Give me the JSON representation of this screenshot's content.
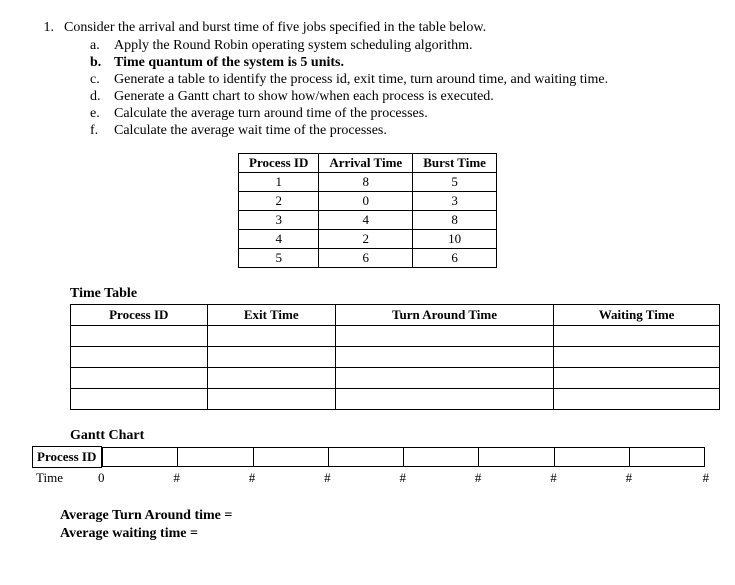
{
  "question": {
    "number": "1.",
    "main": "Consider the arrival and burst time of five jobs specified in the table below.",
    "subs": [
      {
        "letter": "a.",
        "text": "Apply the Round Robin operating system scheduling algorithm.",
        "bold": false
      },
      {
        "letter": "b.",
        "text": "Time quantum of the system is 5 units.",
        "bold": true
      },
      {
        "letter": "c.",
        "text": "Generate a table to identify the process id, exit time, turn around time, and waiting time.",
        "bold": false
      },
      {
        "letter": "d.",
        "text": "Generate a Gantt chart to show how/when each process is executed.",
        "bold": false
      },
      {
        "letter": "e.",
        "text": "Calculate the average turn around time of the processes.",
        "bold": false
      },
      {
        "letter": "f.",
        "text": "Calculate the average wait time of the processes.",
        "bold": false
      }
    ]
  },
  "process_table": {
    "headers": [
      "Process ID",
      "Arrival Time",
      "Burst Time"
    ],
    "rows": [
      [
        "1",
        "8",
        "5"
      ],
      [
        "2",
        "0",
        "3"
      ],
      [
        "3",
        "4",
        "8"
      ],
      [
        "4",
        "2",
        "10"
      ],
      [
        "5",
        "6",
        "6"
      ]
    ]
  },
  "time_table": {
    "heading": "Time Table",
    "headers": [
      "Process ID",
      "Exit Time",
      "Turn Around Time",
      "Waiting Time"
    ],
    "empty_rows": 4
  },
  "gantt": {
    "heading": "Gantt Chart",
    "row_label": "Process ID",
    "time_label": "Time",
    "cells": 8,
    "time_marks": [
      "0",
      "#",
      "#",
      "#",
      "#",
      "#",
      "#",
      "#",
      "#"
    ]
  },
  "averages": {
    "tat_label": "Average Turn Around time =",
    "wt_label": "Average waiting time ="
  }
}
